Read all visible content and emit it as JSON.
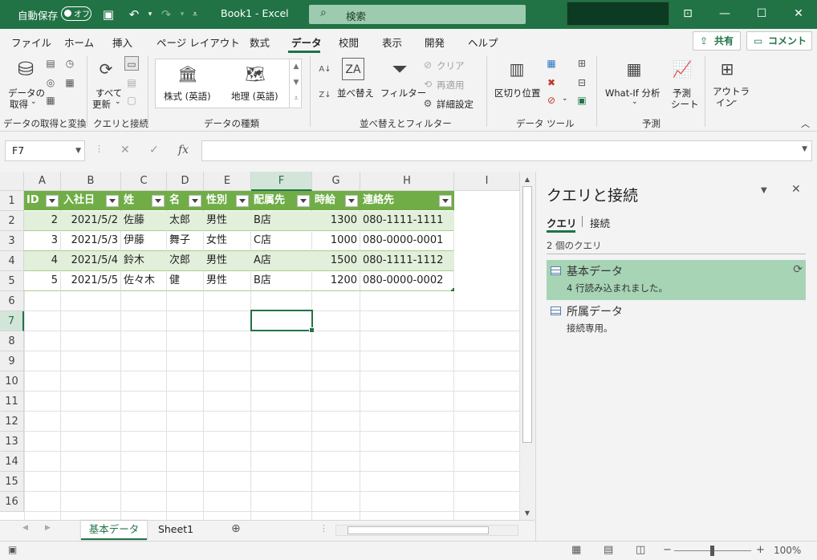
{
  "titlebar": {
    "autosave_label": "自動保存",
    "autosave_state": "オフ",
    "file_title": "Book1  -  Excel",
    "search_label": "検索"
  },
  "menu": {
    "tabs": [
      "ファイル",
      "ホーム",
      "挿入",
      "ページ レイアウト",
      "数式",
      "データ",
      "校閲",
      "表示",
      "開発",
      "ヘルプ"
    ],
    "active_tab": "データ",
    "share_label": "共有",
    "comment_label": "コメント"
  },
  "ribbon": {
    "get_data_label_1": "データの",
    "get_data_label_2": "取得",
    "refresh_all_1": "すべて",
    "refresh_all_2": "更新",
    "stock_label": "株式 (英語)",
    "geo_label": "地理 (英語)",
    "sort_label": "並べ替え",
    "filter_label": "フィルター",
    "clear_label": "クリア",
    "reapply_label": "再適用",
    "advanced_label": "詳細設定",
    "text_to_columns_label": "区切り位置",
    "whatif_label": "What-If 分析",
    "forecast_label_1": "予測",
    "forecast_label_2": "シート",
    "outline_label_1": "アウトラ",
    "outline_label_2": "イン",
    "groups": [
      "データの取得と変換",
      "クエリと接続",
      "データの種類",
      "並べ替えとフィルター",
      "データ ツール",
      "予測"
    ]
  },
  "formula_bar": {
    "name_box": "F7",
    "fx": "fx",
    "value": ""
  },
  "sheet": {
    "columns": [
      "A",
      "B",
      "C",
      "D",
      "E",
      "F",
      "G",
      "H",
      "I"
    ],
    "selected_column": "F",
    "selected_row": "7",
    "rows": [
      "1",
      "2",
      "3",
      "4",
      "5",
      "6",
      "7",
      "8",
      "9",
      "10",
      "11",
      "12",
      "13",
      "14",
      "15",
      "16"
    ],
    "table_headers": [
      "ID",
      "入社日",
      "姓",
      "名",
      "性別",
      "配属先",
      "時給",
      "連絡先"
    ],
    "table_rows": [
      [
        "2",
        "2021/5/2",
        "佐藤",
        "太郎",
        "男性",
        "B店",
        "1300",
        "080-1111-1111"
      ],
      [
        "3",
        "2021/5/3",
        "伊藤",
        "舞子",
        "女性",
        "C店",
        "1000",
        "080-0000-0001"
      ],
      [
        "4",
        "2021/5/4",
        "鈴木",
        "次郎",
        "男性",
        "A店",
        "1500",
        "080-1111-1112"
      ],
      [
        "5",
        "2021/5/5",
        "佐々木",
        "健",
        "男性",
        "B店",
        "1200",
        "080-0000-0002"
      ]
    ]
  },
  "sheet_tabs": [
    "基本データ",
    "Sheet1"
  ],
  "active_sheet": "基本データ",
  "status": {
    "zoom": "100%"
  },
  "pane": {
    "title": "クエリと接続",
    "tabs": [
      "クエリ",
      "接続"
    ],
    "count": "2 個のクエリ",
    "queries": [
      {
        "name": "基本データ",
        "desc": "4 行読み込まれました。"
      },
      {
        "name": "所属データ",
        "desc": "接続専用。"
      }
    ]
  },
  "colors": {
    "accent": "#217346",
    "table_header": "#70ad47",
    "table_band": "#e2efda",
    "query_selected": "#a7d4b5"
  }
}
